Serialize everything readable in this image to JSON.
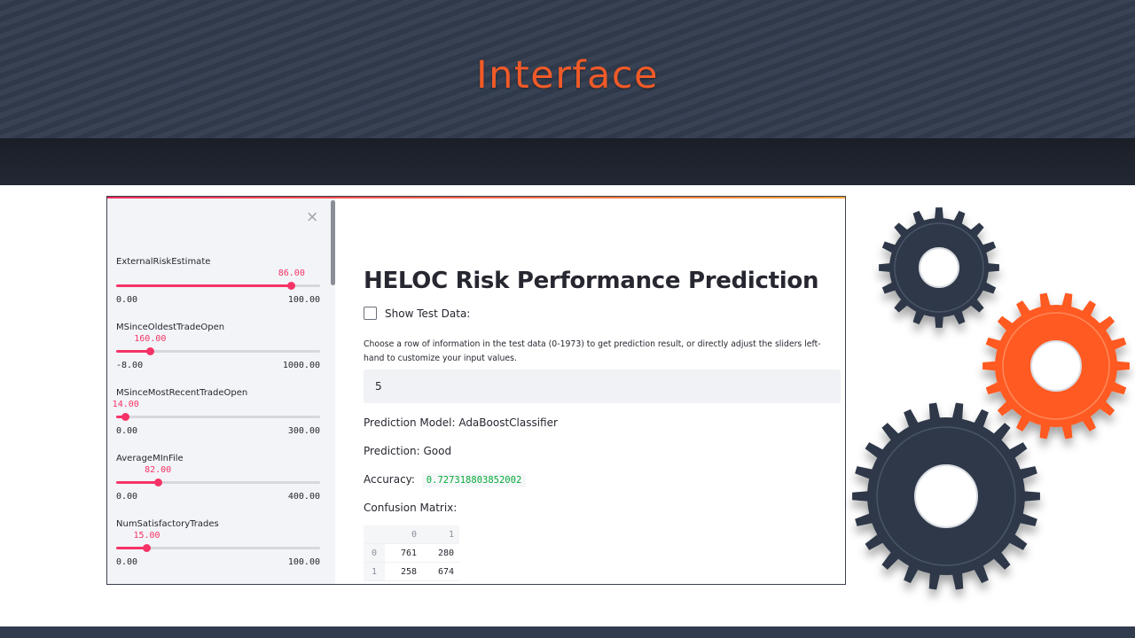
{
  "slide": {
    "title": "Interface"
  },
  "sidebar": {
    "close_icon": "×",
    "sliders": [
      {
        "label": "ExternalRiskEstimate",
        "value": "86.00",
        "min": "0.00",
        "max": "100.00",
        "fraction": 0.86
      },
      {
        "label": "MSinceOldestTradeOpen",
        "value": "160.00",
        "min": "-8.00",
        "max": "1000.00",
        "fraction": 0.1667
      },
      {
        "label": "MSinceMostRecentTradeOpen",
        "value": "14.00",
        "min": "0.00",
        "max": "300.00",
        "fraction": 0.0467
      },
      {
        "label": "AverageMInFile",
        "value": "82.00",
        "min": "0.00",
        "max": "400.00",
        "fraction": 0.205
      },
      {
        "label": "NumSatisfactoryTrades",
        "value": "15.00",
        "min": "0.00",
        "max": "100.00",
        "fraction": 0.15
      }
    ]
  },
  "main": {
    "title": "HELOC Risk Performance Prediction",
    "checkbox_label": "Show Test Data:",
    "checkbox_checked": false,
    "description": "Choose a row of information in the test data (0-1973) to get prediction result, or directly adjust the sliders left-hand to customize your input values.",
    "row_input_value": "5",
    "prediction_model": "Prediction Model: AdaBoostClassifier",
    "prediction": "Prediction: Good",
    "accuracy_label": "Accuracy:",
    "accuracy_value": "0.727318803852002",
    "confusion_matrix_label": "Confusion Matrix:",
    "confusion_matrix": {
      "columns": [
        "0",
        "1"
      ],
      "rows": [
        {
          "index": "0",
          "values": [
            "761",
            "280"
          ]
        },
        {
          "index": "1",
          "values": [
            "258",
            "674"
          ]
        }
      ]
    }
  },
  "colors": {
    "banner": "#323c4e",
    "title_orange": "#f05a28",
    "slider_accent": "#f63366",
    "accuracy_green": "#09ab3b",
    "gear_dark": "#2f3848",
    "gear_orange": "#ff5a23"
  },
  "icons": [
    "close-icon",
    "gear-icon"
  ]
}
